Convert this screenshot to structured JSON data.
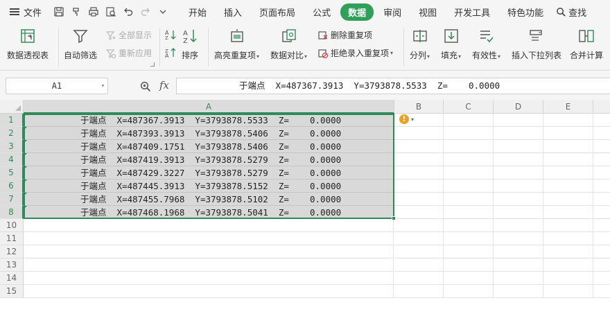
{
  "menu": {
    "label": "文件"
  },
  "quick_access": [
    "save-icon",
    "format-painter-icon",
    "print-icon",
    "print-preview-icon",
    "undo-icon",
    "redo-icon",
    "more-icon"
  ],
  "tabs": [
    {
      "label": "开始",
      "active": false
    },
    {
      "label": "插入",
      "active": false
    },
    {
      "label": "页面布局",
      "active": false
    },
    {
      "label": "公式",
      "active": false
    },
    {
      "label": "数据",
      "active": true
    },
    {
      "label": "审阅",
      "active": false
    },
    {
      "label": "视图",
      "active": false
    },
    {
      "label": "开发工具",
      "active": false
    },
    {
      "label": "特色功能",
      "active": false
    }
  ],
  "search": {
    "label": "查找"
  },
  "ribbon": {
    "pivot": "数据透视表",
    "autofilter": "自动筛选",
    "show_all": "全部显示",
    "reapply": "重新应用",
    "sort": "排序",
    "highlight_dup": "高亮重复项",
    "compare": "数据对比",
    "remove_dup": "删除重复项",
    "reject_dup": "拒绝录入重复项",
    "split": "分列",
    "fill": "填充",
    "validity": "有效性",
    "dropdown_list": "插入下拉列表",
    "consolidate": "合并计算"
  },
  "formula_bar": {
    "name_box": "A1",
    "fx": "fx",
    "value": "于端点  X=487367.3913  Y=3793878.5533  Z=    0.0000"
  },
  "columns": [
    "A",
    "B",
    "C",
    "D",
    "E"
  ],
  "rows": [
    {
      "num": "1",
      "a": "于端点  X=487367.3913  Y=3793878.5533  Z=    0.0000"
    },
    {
      "num": "2",
      "a": "于端点  X=487393.3913  Y=3793878.5406  Z=    0.0000"
    },
    {
      "num": "3",
      "a": "于端点  X=487409.1751  Y=3793878.5406  Z=    0.0000"
    },
    {
      "num": "4",
      "a": "于端点  X=487419.3913  Y=3793878.5279  Z=    0.0000"
    },
    {
      "num": "5",
      "a": "于端点  X=487429.3227  Y=3793878.5279  Z=    0.0000"
    },
    {
      "num": "6",
      "a": "于端点  X=487445.3913  Y=3793878.5152  Z=    0.0000"
    },
    {
      "num": "7",
      "a": "于端点  X=487455.7968  Y=3793878.5102  Z=    0.0000"
    },
    {
      "num": "8",
      "a": "于端点  X=487468.1968  Y=3793878.5041  Z=    0.0000"
    },
    {
      "num": "10",
      "a": ""
    },
    {
      "num": "11",
      "a": ""
    },
    {
      "num": "12",
      "a": ""
    },
    {
      "num": "13",
      "a": ""
    },
    {
      "num": "14",
      "a": ""
    },
    {
      "num": "15",
      "a": ""
    }
  ],
  "colors": {
    "accent": "#2ea05a",
    "selection": "#2e8b57",
    "warning": "#f0a020"
  }
}
